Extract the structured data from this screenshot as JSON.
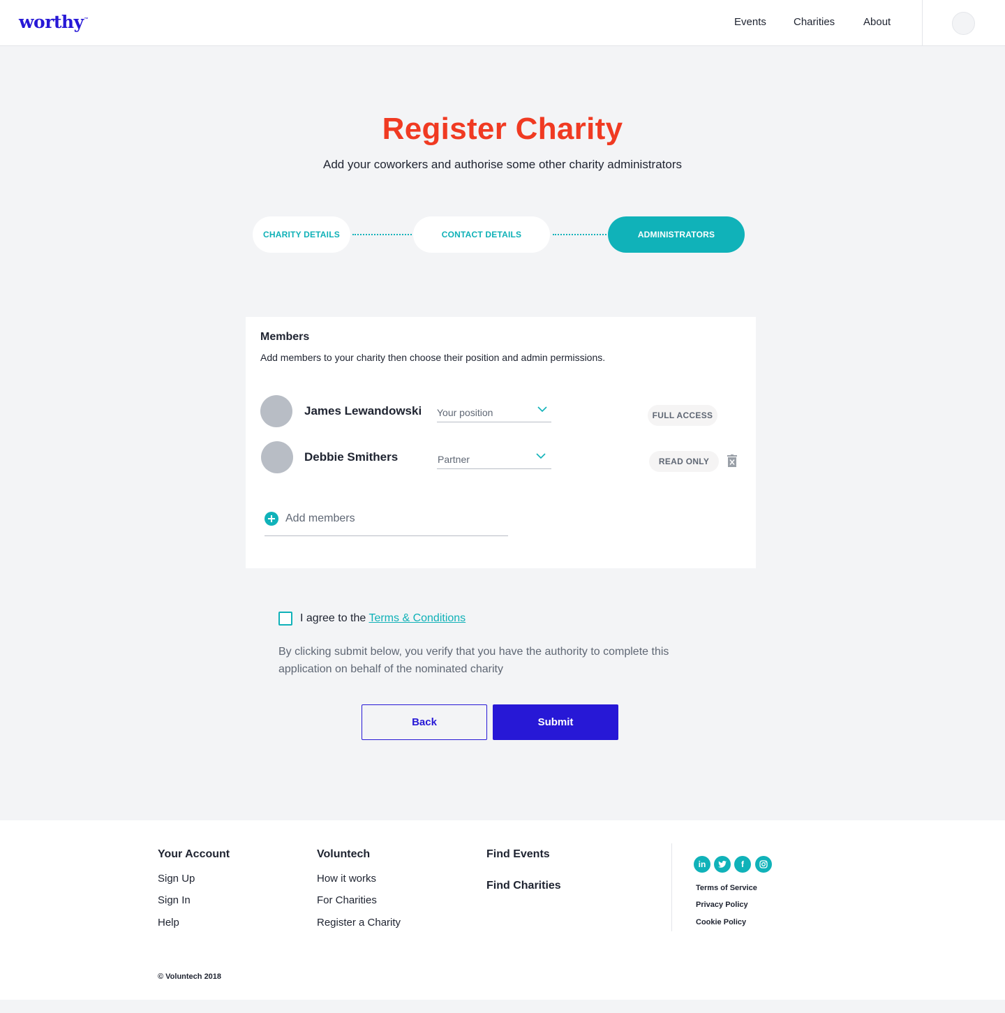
{
  "header": {
    "logo": "worthy",
    "logo_mark": "™",
    "nav": [
      "Events",
      "Charities",
      "About"
    ]
  },
  "page": {
    "title": "Register Charity",
    "subtitle": "Add your coworkers and authorise some other charity administrators"
  },
  "steps": [
    {
      "label": "CHARITY DETAILS",
      "active": false
    },
    {
      "label": "CONTACT DETAILS",
      "active": false
    },
    {
      "label": "ADMINISTRATORS",
      "active": true
    }
  ],
  "members": {
    "title": "Members",
    "description": "Add members to your charity then choose their position and admin permissions.",
    "rows": [
      {
        "name": "James Lewandowski",
        "position": "Your position",
        "access": "FULL ACCESS"
      },
      {
        "name": "Debbie Smithers",
        "position": "Partner",
        "access": "READ ONLY"
      }
    ],
    "add_label": "Add members"
  },
  "agreement": {
    "prefix": "I agree to the ",
    "link": "Terms & Conditions",
    "checked": false,
    "verify_text": "By clicking submit below, you verify that you have the authority to complete this application on behalf of the nominated charity"
  },
  "buttons": {
    "back": "Back",
    "submit": "Submit"
  },
  "footer": {
    "your_account": {
      "title": "Your Account",
      "links": [
        "Sign Up",
        "Sign In",
        "Help"
      ]
    },
    "voluntech": {
      "title": "Voluntech",
      "links": [
        "How it works",
        "For Charities",
        "Register a Charity"
      ]
    },
    "find_events": "Find Events",
    "find_charities": "Find Charities",
    "social": [
      "linkedin-icon",
      "twitter-icon",
      "facebook-icon",
      "instagram-icon"
    ],
    "legal": [
      "Terms of Service",
      "Privacy Policy",
      "Cookie Policy"
    ],
    "copyright": "© Voluntech 2018"
  },
  "colors": {
    "brand": "#2718d6",
    "accent": "#10b2b9",
    "title": "#f03a22",
    "background": "#f3f4f6"
  }
}
